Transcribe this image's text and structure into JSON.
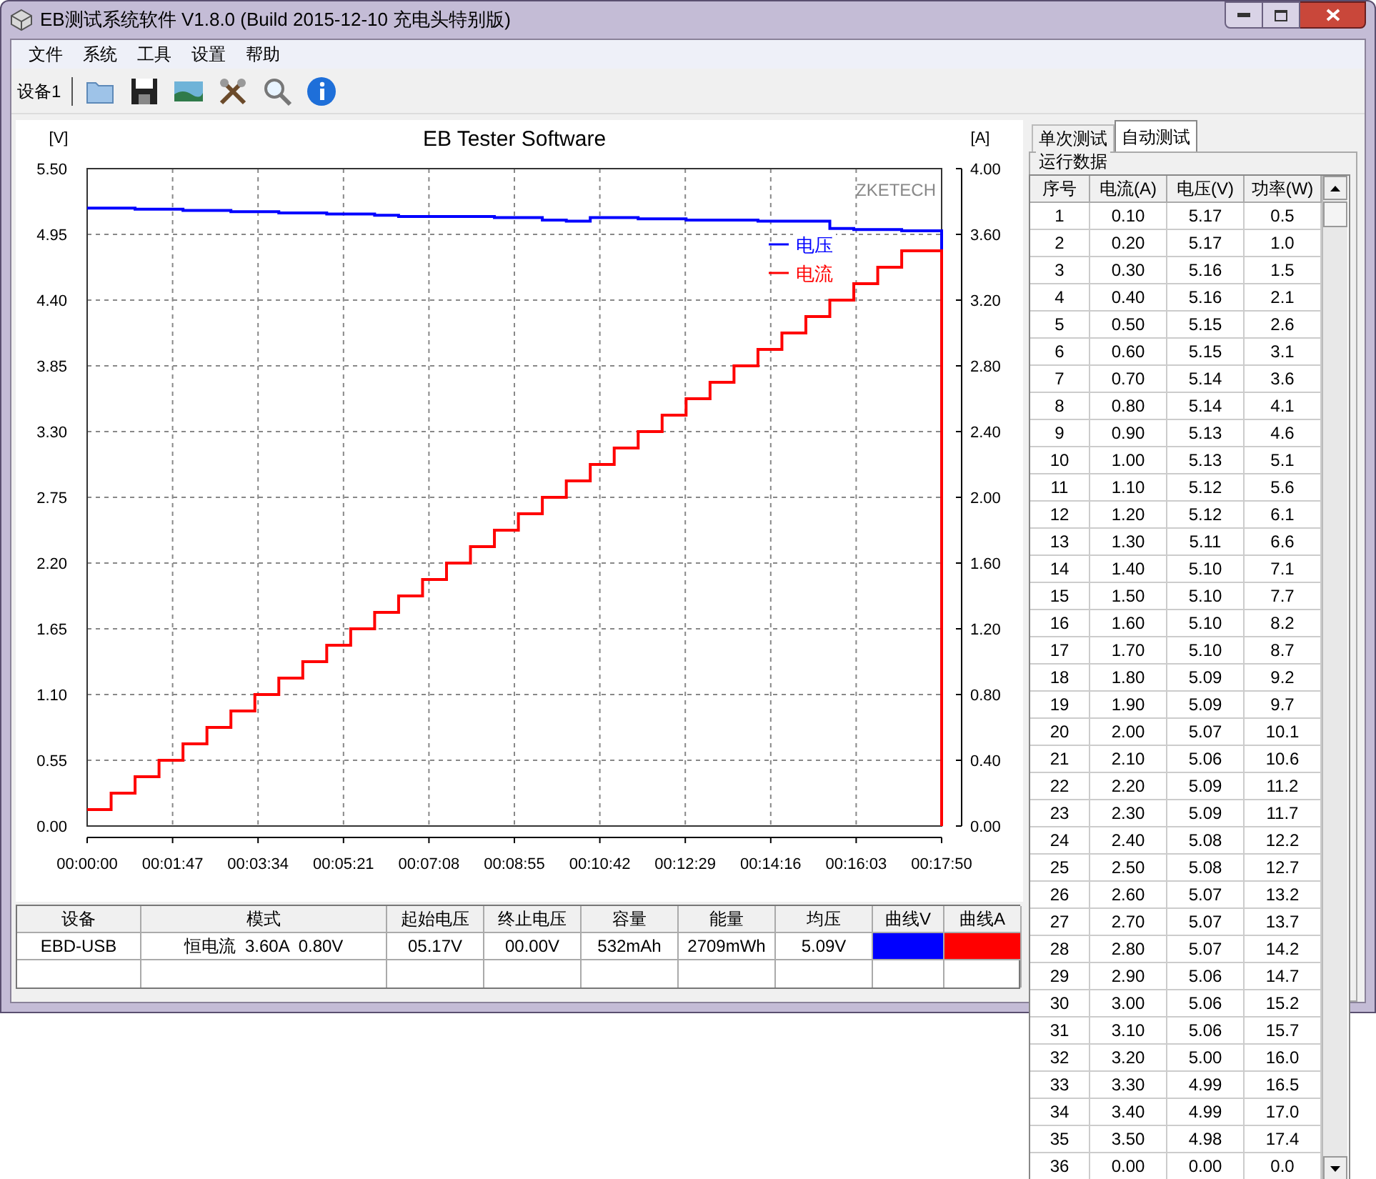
{
  "window": {
    "title": "EB测试系统软件 V1.8.0 (Build 2015-12-10 充电头特别版)"
  },
  "menu": [
    "文件",
    "系统",
    "工具",
    "设置",
    "帮助"
  ],
  "toolbar": {
    "device_label": "设备1"
  },
  "chart": {
    "brand": "ZKETECH",
    "chart_data": {
      "type": "line",
      "title": "EB Tester Software",
      "ylabel": "[V]",
      "y2label": "[A]",
      "grid": true,
      "legend": true,
      "x": [
        0,
        30,
        30,
        60,
        60,
        90,
        90,
        120,
        120,
        150,
        150,
        180,
        180,
        210,
        210,
        240,
        240,
        270,
        270,
        300,
        300,
        330,
        330,
        360,
        360,
        390,
        390,
        420,
        420,
        450,
        450,
        480,
        480,
        510,
        510,
        540,
        540,
        570,
        570,
        600,
        600,
        630,
        630,
        660,
        660,
        690,
        690,
        720,
        720,
        750,
        750,
        780,
        780,
        810,
        810,
        840,
        840,
        870,
        870,
        900,
        900,
        930,
        930,
        960,
        960,
        990,
        990,
        1020,
        1020,
        1070,
        1070
      ],
      "series": [
        {
          "name": "电压",
          "color": "#0000ff",
          "values": [
            5.17,
            5.17,
            5.17,
            5.17,
            5.16,
            5.16,
            5.16,
            5.16,
            5.15,
            5.15,
            5.15,
            5.15,
            5.14,
            5.14,
            5.14,
            5.14,
            5.13,
            5.13,
            5.13,
            5.13,
            5.12,
            5.12,
            5.12,
            5.12,
            5.11,
            5.11,
            5.1,
            5.1,
            5.1,
            5.1,
            5.1,
            5.1,
            5.1,
            5.1,
            5.09,
            5.09,
            5.09,
            5.09,
            5.07,
            5.07,
            5.06,
            5.06,
            5.09,
            5.09,
            5.09,
            5.09,
            5.08,
            5.08,
            5.08,
            5.08,
            5.07,
            5.07,
            5.07,
            5.07,
            5.07,
            5.07,
            5.06,
            5.06,
            5.06,
            5.06,
            5.06,
            5.06,
            5.0,
            5.0,
            4.99,
            4.99,
            4.99,
            4.99,
            4.98,
            4.98,
            0.0
          ]
        },
        {
          "name": "电流",
          "color": "#ff0000",
          "axis": "y2",
          "values": [
            0.1,
            0.1,
            0.2,
            0.2,
            0.3,
            0.3,
            0.4,
            0.4,
            0.5,
            0.5,
            0.6,
            0.6,
            0.7,
            0.7,
            0.8,
            0.8,
            0.9,
            0.9,
            1.0,
            1.0,
            1.1,
            1.1,
            1.2,
            1.2,
            1.3,
            1.3,
            1.4,
            1.4,
            1.5,
            1.5,
            1.6,
            1.6,
            1.7,
            1.7,
            1.8,
            1.8,
            1.9,
            1.9,
            2.0,
            2.0,
            2.1,
            2.1,
            2.2,
            2.2,
            2.3,
            2.3,
            2.4,
            2.4,
            2.5,
            2.5,
            2.6,
            2.6,
            2.7,
            2.7,
            2.8,
            2.8,
            2.9,
            2.9,
            3.0,
            3.0,
            3.1,
            3.1,
            3.2,
            3.2,
            3.3,
            3.3,
            3.4,
            3.4,
            3.5,
            3.5,
            0.0
          ]
        }
      ],
      "xlim": [
        0,
        1070
      ],
      "ylim": [
        0,
        5.5
      ],
      "y2lim": [
        0,
        4
      ],
      "xticks": [
        {
          "value": 0,
          "label": "00:00:00"
        },
        {
          "value": 107,
          "label": "00:01:47"
        },
        {
          "value": 214,
          "label": "00:03:34"
        },
        {
          "value": 321,
          "label": "00:05:21"
        },
        {
          "value": 428,
          "label": "00:07:08"
        },
        {
          "value": 535,
          "label": "00:08:55"
        },
        {
          "value": 642,
          "label": "00:10:42"
        },
        {
          "value": 749,
          "label": "00:12:29"
        },
        {
          "value": 856,
          "label": "00:14:16"
        },
        {
          "value": 963,
          "label": "00:16:03"
        },
        {
          "value": 1070,
          "label": "00:17:50"
        }
      ],
      "yticks": [
        {
          "value": 0,
          "label": "0.00"
        },
        {
          "value": 0.55,
          "label": "0.55"
        },
        {
          "value": 1.1,
          "label": "1.10"
        },
        {
          "value": 1.65,
          "label": "1.65"
        },
        {
          "value": 2.2,
          "label": "2.20"
        },
        {
          "value": 2.75,
          "label": "2.75"
        },
        {
          "value": 3.3,
          "label": "3.30"
        },
        {
          "value": 3.85,
          "label": "3.85"
        },
        {
          "value": 4.4,
          "label": "4.40"
        },
        {
          "value": 4.95,
          "label": "4.95"
        },
        {
          "value": 5.5,
          "label": "5.50"
        }
      ],
      "y2ticks": [
        {
          "value": 0,
          "label": "0.00"
        },
        {
          "value": 0.4,
          "label": "0.40"
        },
        {
          "value": 0.8,
          "label": "0.80"
        },
        {
          "value": 1.2,
          "label": "1.20"
        },
        {
          "value": 1.6,
          "label": "1.60"
        },
        {
          "value": 2.0,
          "label": "2.00"
        },
        {
          "value": 2.4,
          "label": "2.40"
        },
        {
          "value": 2.8,
          "label": "2.80"
        },
        {
          "value": 3.2,
          "label": "3.20"
        },
        {
          "value": 3.6,
          "label": "3.60"
        },
        {
          "value": 4.0,
          "label": "4.00"
        }
      ]
    }
  },
  "summary_table": {
    "columns": [
      "设备",
      "模式",
      "起始电压",
      "终止电压",
      "容量",
      "能量",
      "均压",
      "曲线V",
      "曲线A"
    ],
    "rows": [
      [
        {
          "kind": "text",
          "text": "EBD-USB"
        },
        {
          "kind": "text",
          "text": "恒电流  3.60A  0.80V"
        },
        {
          "kind": "text",
          "text": "05.17V"
        },
        {
          "kind": "text",
          "text": "00.00V"
        },
        {
          "kind": "text",
          "text": "532mAh"
        },
        {
          "kind": "text",
          "text": "2709mWh"
        },
        {
          "kind": "text",
          "text": "5.09V"
        },
        {
          "kind": "swatch",
          "color": "#0000ff"
        },
        {
          "kind": "swatch",
          "color": "#ff0000"
        }
      ]
    ]
  },
  "side_panel": {
    "tabs": [
      {
        "label": "单次测试",
        "selected": false
      },
      {
        "label": "自动测试",
        "selected": true
      }
    ],
    "group_title": "运行数据",
    "columns": [
      "序号",
      "电流(A)",
      "电压(V)",
      "功率(W)"
    ],
    "rows": [
      [
        "1",
        "0.10",
        "5.17",
        "0.5"
      ],
      [
        "2",
        "0.20",
        "5.17",
        "1.0"
      ],
      [
        "3",
        "0.30",
        "5.16",
        "1.5"
      ],
      [
        "4",
        "0.40",
        "5.16",
        "2.1"
      ],
      [
        "5",
        "0.50",
        "5.15",
        "2.6"
      ],
      [
        "6",
        "0.60",
        "5.15",
        "3.1"
      ],
      [
        "7",
        "0.70",
        "5.14",
        "3.6"
      ],
      [
        "8",
        "0.80",
        "5.14",
        "4.1"
      ],
      [
        "9",
        "0.90",
        "5.13",
        "4.6"
      ],
      [
        "10",
        "1.00",
        "5.13",
        "5.1"
      ],
      [
        "11",
        "1.10",
        "5.12",
        "5.6"
      ],
      [
        "12",
        "1.20",
        "5.12",
        "6.1"
      ],
      [
        "13",
        "1.30",
        "5.11",
        "6.6"
      ],
      [
        "14",
        "1.40",
        "5.10",
        "7.1"
      ],
      [
        "15",
        "1.50",
        "5.10",
        "7.7"
      ],
      [
        "16",
        "1.60",
        "5.10",
        "8.2"
      ],
      [
        "17",
        "1.70",
        "5.10",
        "8.7"
      ],
      [
        "18",
        "1.80",
        "5.09",
        "9.2"
      ],
      [
        "19",
        "1.90",
        "5.09",
        "9.7"
      ],
      [
        "20",
        "2.00",
        "5.07",
        "10.1"
      ],
      [
        "21",
        "2.10",
        "5.06",
        "10.6"
      ],
      [
        "22",
        "2.20",
        "5.09",
        "11.2"
      ],
      [
        "23",
        "2.30",
        "5.09",
        "11.7"
      ],
      [
        "24",
        "2.40",
        "5.08",
        "12.2"
      ],
      [
        "25",
        "2.50",
        "5.08",
        "12.7"
      ],
      [
        "26",
        "2.60",
        "5.07",
        "13.2"
      ],
      [
        "27",
        "2.70",
        "5.07",
        "13.7"
      ],
      [
        "28",
        "2.80",
        "5.07",
        "14.2"
      ],
      [
        "29",
        "2.90",
        "5.06",
        "14.7"
      ],
      [
        "30",
        "3.00",
        "5.06",
        "15.2"
      ],
      [
        "31",
        "3.10",
        "5.06",
        "15.7"
      ],
      [
        "32",
        "3.20",
        "5.00",
        "16.0"
      ],
      [
        "33",
        "3.30",
        "4.99",
        "16.5"
      ],
      [
        "34",
        "3.40",
        "4.99",
        "17.0"
      ],
      [
        "35",
        "3.50",
        "4.98",
        "17.4"
      ],
      [
        "36",
        "0.00",
        "0.00",
        "0.0"
      ]
    ]
  }
}
